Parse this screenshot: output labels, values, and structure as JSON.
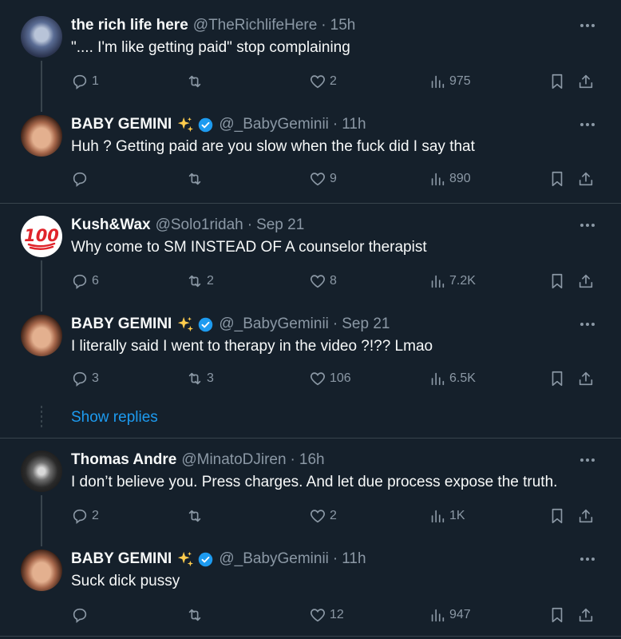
{
  "colors": {
    "background": "#15202b",
    "text": "#f7f9f9",
    "muted": "#8b98a5",
    "accent": "#1d9bf0",
    "verified": "#1d9bf0",
    "sparkle": "#ffcc4d",
    "divider": "#38444d"
  },
  "threads": [
    {
      "posts": [
        {
          "name": "the rich life here",
          "handle": "@TheRichlifeHere",
          "time": "15h",
          "text": "\".... I'm like getting paid\" stop complaining",
          "replies": "1",
          "retweets": "",
          "likes": "2",
          "views": "975",
          "avatar": "photo-avatar"
        },
        {
          "name": "BABY GEMINI",
          "handle": "@_BabyGeminii",
          "time": "11h",
          "text": "Huh ? Getting paid are you slow when the fuck did I say that",
          "replies": "",
          "retweets": "",
          "likes": "9",
          "views": "890",
          "avatar": "photo-avatar"
        }
      ]
    },
    {
      "posts": [
        {
          "name": "Kush&Wax",
          "handle": "@Solo1ridah",
          "time": "Sep 21",
          "text": "Why come to SM INSTEAD OF A counselor therapist",
          "replies": "6",
          "retweets": "2",
          "likes": "8",
          "views": "7.2K",
          "avatar": "hundred-emoji-avatar"
        },
        {
          "name": "BABY GEMINI",
          "handle": "@_BabyGeminii",
          "time": "Sep 21",
          "text": "I literally said I went to therapy in the video ?!?? Lmao",
          "replies": "3",
          "retweets": "3",
          "likes": "106",
          "views": "6.5K",
          "avatar": "photo-avatar"
        }
      ],
      "show_replies": "Show replies"
    },
    {
      "posts": [
        {
          "name": "Thomas Andre",
          "handle": "@MinatoDJiren",
          "time": "16h",
          "text": "I don’t believe you. Press charges. And let due process expose the truth.",
          "replies": "2",
          "retweets": "",
          "likes": "2",
          "views": "1K",
          "avatar": "photo-avatar"
        },
        {
          "name": "BABY GEMINI",
          "handle": "@_BabyGeminii",
          "time": "11h",
          "text": "Suck dick pussy",
          "replies": "",
          "retweets": "",
          "likes": "12",
          "views": "947",
          "avatar": "photo-avatar"
        }
      ]
    }
  ],
  "icons": {
    "reply": "reply-icon",
    "retweet": "retweet-icon",
    "like": "heart-icon",
    "views": "views-icon",
    "bookmark": "bookmark-icon",
    "share": "share-icon",
    "more": "more-icon",
    "sparkle": "sparkles-icon",
    "verified": "verified-badge-icon"
  }
}
